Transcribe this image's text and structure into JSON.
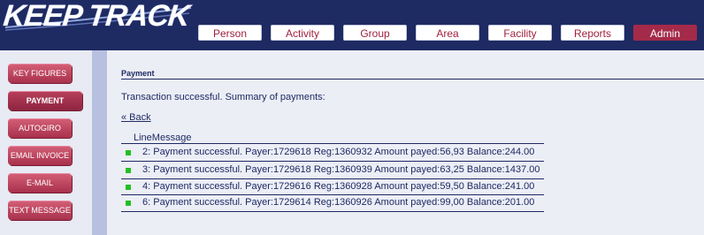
{
  "app": {
    "logo_text": "KEEP TRACK"
  },
  "nav": {
    "items": [
      {
        "label": "Person"
      },
      {
        "label": "Activity"
      },
      {
        "label": "Group"
      },
      {
        "label": "Area"
      },
      {
        "label": "Facility"
      },
      {
        "label": "Reports"
      },
      {
        "label": "Admin"
      }
    ],
    "active": "Admin"
  },
  "sidebar": {
    "items": [
      {
        "label": "KEY FIGURES"
      },
      {
        "label": "PAYMENT"
      },
      {
        "label": "AUTOGIRO"
      },
      {
        "label": "EMAIL INVOICE"
      },
      {
        "label": "E-MAIL"
      },
      {
        "label": "TEXT MESSAGE"
      }
    ],
    "active": "PAYMENT"
  },
  "main": {
    "section_title": "Payment",
    "summary": "Transaction successful. Summary of payments:",
    "back_link": "« Back",
    "table": {
      "header": "LineMessage",
      "rows": [
        {
          "text": "2: Payment successful. Payer:1729618 Reg:1360932 Amount payed:56,93 Balance:244.00"
        },
        {
          "text": "3: Payment successful. Payer:1729618 Reg:1360939 Amount payed:63,25 Balance:1437.00"
        },
        {
          "text": "4: Payment successful. Payer:1729616 Reg:1360928 Amount payed:59,50 Balance:241.00"
        },
        {
          "text": "6: Payment successful. Payer:1729614 Reg:1360926 Amount payed:99,00 Balance:201.00"
        }
      ]
    }
  },
  "colors": {
    "header_bg": "#1e2a62",
    "accent": "#a42a4a",
    "status_ok": "#22c022",
    "sidebar_btn": "#c04866"
  }
}
